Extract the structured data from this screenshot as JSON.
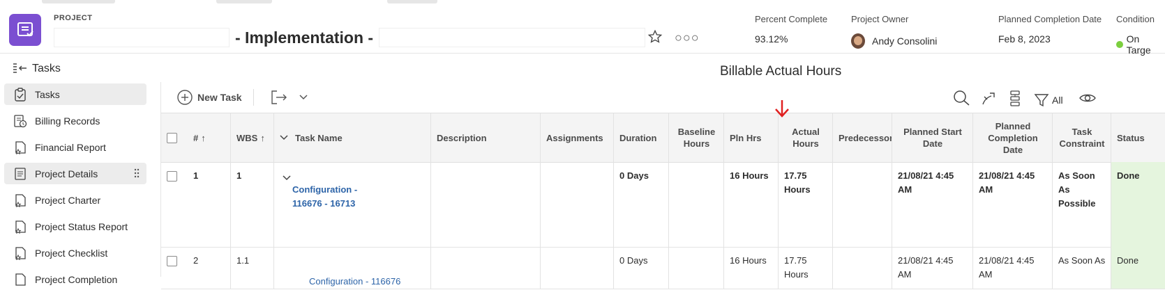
{
  "header": {
    "label": "PROJECT",
    "title": "- Implementation -",
    "meta": [
      {
        "key": "Percent Complete",
        "value": "93.12%"
      },
      {
        "key": "Project Owner",
        "value": "Andy Consolini"
      },
      {
        "key": "Planned Completion Date",
        "value": "Feb 8, 2023"
      },
      {
        "key": "Condition",
        "value": "On Targe"
      }
    ]
  },
  "tasksbar": {
    "label": "Tasks",
    "annotation": "Billable Actual Hours"
  },
  "sidebar": {
    "items": [
      {
        "label": "Tasks",
        "icon": "tasks-icon"
      },
      {
        "label": "Billing Records",
        "icon": "billing-records-icon"
      },
      {
        "label": "Financial Report",
        "icon": "report-icon"
      },
      {
        "label": "Project Details",
        "icon": "details-icon"
      },
      {
        "label": "Project Charter",
        "icon": "report-icon"
      },
      {
        "label": "Project Status Report",
        "icon": "report-icon"
      },
      {
        "label": "Project Checklist",
        "icon": "report-icon"
      },
      {
        "label": "Project Completion",
        "icon": "report-icon"
      }
    ]
  },
  "toolbar": {
    "new_task": "New Task",
    "filter_label": "All"
  },
  "table": {
    "headers": {
      "num": "#",
      "wbs": "WBS",
      "task_name": "Task Name",
      "description": "Description",
      "assignments": "Assignments",
      "duration": "Duration",
      "baseline_hours": "Baseline Hours",
      "pln_hrs": "Pln Hrs",
      "actual_hours": "Actual Hours",
      "predecessors": "Predecessors",
      "planned_start": "Planned Start Date",
      "planned_completion": "Planned Completion Date",
      "task_constraint": "Task Constraint",
      "status": "Status"
    },
    "rows": [
      {
        "num": "1",
        "wbs": "1",
        "task_name": "Configuration - 116676 - 16713",
        "duration": "0 Days",
        "pln_hrs": "16 Hours",
        "actual_hours": "17.75 Hours",
        "planned_start": "21/08/21 4:45 AM",
        "planned_completion": "21/08/21 4:45 AM",
        "task_constraint": "As Soon As Possible",
        "status": "Done"
      },
      {
        "num": "2",
        "wbs": "1.1",
        "task_name": "Configuration - 116676",
        "duration": "0 Days",
        "pln_hrs": "16 Hours",
        "actual_hours": "17.75 Hours",
        "planned_start": "21/08/21 4:45 AM",
        "planned_completion": "21/08/21 4:45 AM",
        "task_constraint": "As Soon As",
        "status": "Done"
      }
    ]
  },
  "colors": {
    "accent": "#7b4fd1",
    "link": "#2d64a8",
    "done": "#e5f5de",
    "on_target": "#7ccf3f",
    "annotation": "#e02020"
  }
}
